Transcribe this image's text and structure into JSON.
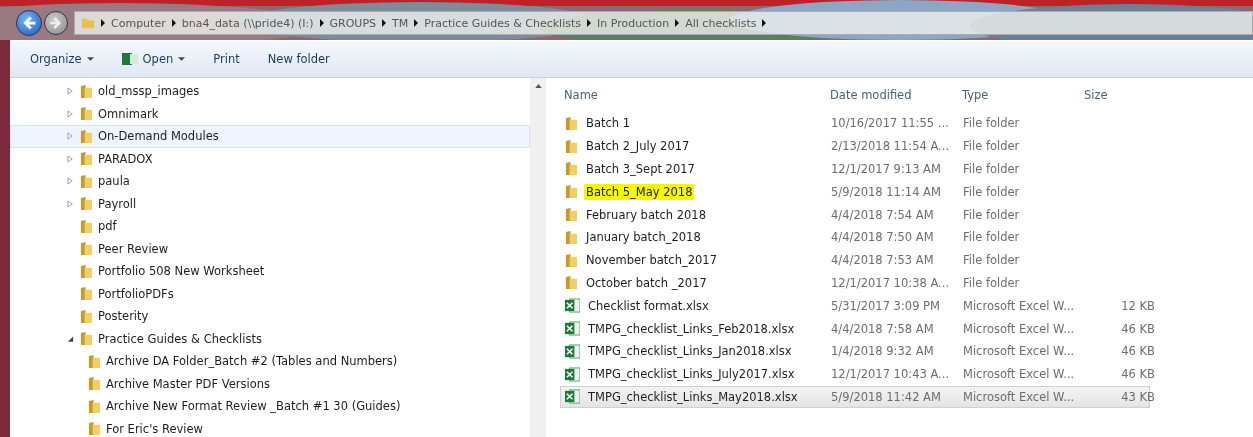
{
  "address_bar": {
    "crumbs": [
      "Computer",
      "bna4_data (\\\\pride4) (I:)",
      "GROUPS",
      "TM",
      "Practice Guides & Checklists",
      "In Production",
      "All checklists"
    ]
  },
  "toolbar": {
    "items": [
      {
        "label": "Organize",
        "kind": "menu"
      },
      {
        "label": "Open",
        "kind": "open"
      },
      {
        "label": "Print",
        "kind": "plain"
      },
      {
        "label": "New folder",
        "kind": "plain"
      }
    ]
  },
  "tree": [
    {
      "label": "old_mssp_images",
      "expanded": false,
      "hovered": false
    },
    {
      "label": "Omnimark",
      "expanded": false,
      "hovered": false
    },
    {
      "label": "On-Demand Modules",
      "expanded": false,
      "hovered": true
    },
    {
      "label": "PARADOX",
      "expanded": false,
      "hovered": false
    },
    {
      "label": "paula",
      "expanded": false,
      "hovered": false
    },
    {
      "label": "Payroll",
      "expanded": false,
      "hovered": false
    },
    {
      "label": "pdf",
      "hovered": false
    },
    {
      "label": "Peer Review",
      "hovered": false
    },
    {
      "label": "Portfolio 508 New Worksheet",
      "hovered": false
    },
    {
      "label": "PortfolioPDFs",
      "hovered": false
    },
    {
      "label": "Posterity",
      "hovered": false
    },
    {
      "label": "Practice Guides & Checklists",
      "expanded": true,
      "hovered": false,
      "children": [
        {
          "label": "Archive DA Folder_Batch #2 (Tables and Numbers)",
          "hovered": false
        },
        {
          "label": "Archive Master PDF Versions",
          "hovered": false
        },
        {
          "label": "Archive New Format Review _Batch #1  30 (Guides)",
          "hovered": false
        },
        {
          "label": "For Eric's Review",
          "hovered": false
        }
      ]
    }
  ],
  "file_list": {
    "columns": [
      "Name",
      "Date modified",
      "Type",
      "Size"
    ],
    "rows": [
      {
        "kind": "folder",
        "name": "Batch 1",
        "date": "10/16/2017 11:55 ...",
        "type": "File folder",
        "highlighted": false,
        "selected": false
      },
      {
        "kind": "folder",
        "name": "Batch 2_July 2017",
        "date": "2/13/2018 11:54 A...",
        "type": "File folder",
        "highlighted": false,
        "selected": false
      },
      {
        "kind": "folder",
        "name": "Batch 3_Sept 2017",
        "date": "12/1/2017 9:13 AM",
        "type": "File folder",
        "highlighted": false,
        "selected": false
      },
      {
        "kind": "folder",
        "name": "Batch 5_May 2018",
        "date": "5/9/2018 11:14 AM",
        "type": "File folder",
        "highlighted": true,
        "selected": false
      },
      {
        "kind": "folder",
        "name": "February batch 2018",
        "date": "4/4/2018 7:54 AM",
        "type": "File folder",
        "highlighted": false,
        "selected": false
      },
      {
        "kind": "folder",
        "name": "January batch_2018",
        "date": "4/4/2018 7:50 AM",
        "type": "File folder",
        "highlighted": false,
        "selected": false
      },
      {
        "kind": "folder",
        "name": "November batch_2017",
        "date": "4/4/2018 7:53 AM",
        "type": "File folder",
        "highlighted": false,
        "selected": false
      },
      {
        "kind": "folder",
        "name": "October batch _2017",
        "date": "12/1/2017 10:38 A...",
        "type": "File folder",
        "highlighted": false,
        "selected": false
      },
      {
        "kind": "excel",
        "name": "Checklist format.xlsx",
        "date": "5/31/2017 3:09 PM",
        "type": "Microsoft Excel W...",
        "size": "12 KB",
        "highlighted": false,
        "selected": false
      },
      {
        "kind": "excel",
        "name": "TMPG_checklist_Links_Feb2018.xlsx",
        "date": "4/4/2018 7:58 AM",
        "type": "Microsoft Excel W...",
        "size": "46 KB",
        "highlighted": false,
        "selected": false
      },
      {
        "kind": "excel",
        "name": "TMPG_checklist_Links_Jan2018.xlsx",
        "date": "1/4/2018 9:32 AM",
        "type": "Microsoft Excel W...",
        "size": "46 KB",
        "highlighted": false,
        "selected": false
      },
      {
        "kind": "excel",
        "name": "TMPG_checklist_Links_July2017.xlsx",
        "date": "12/1/2017 10:43 A...",
        "type": "Microsoft Excel W...",
        "size": "46 KB",
        "highlighted": false,
        "selected": false
      },
      {
        "kind": "excel",
        "name": "TMPG_checklist_Links_May2018.xlsx",
        "date": "5/9/2018 11:42 AM",
        "type": "Microsoft Excel W...",
        "size": "43 KB",
        "highlighted": false,
        "selected": true
      }
    ]
  }
}
